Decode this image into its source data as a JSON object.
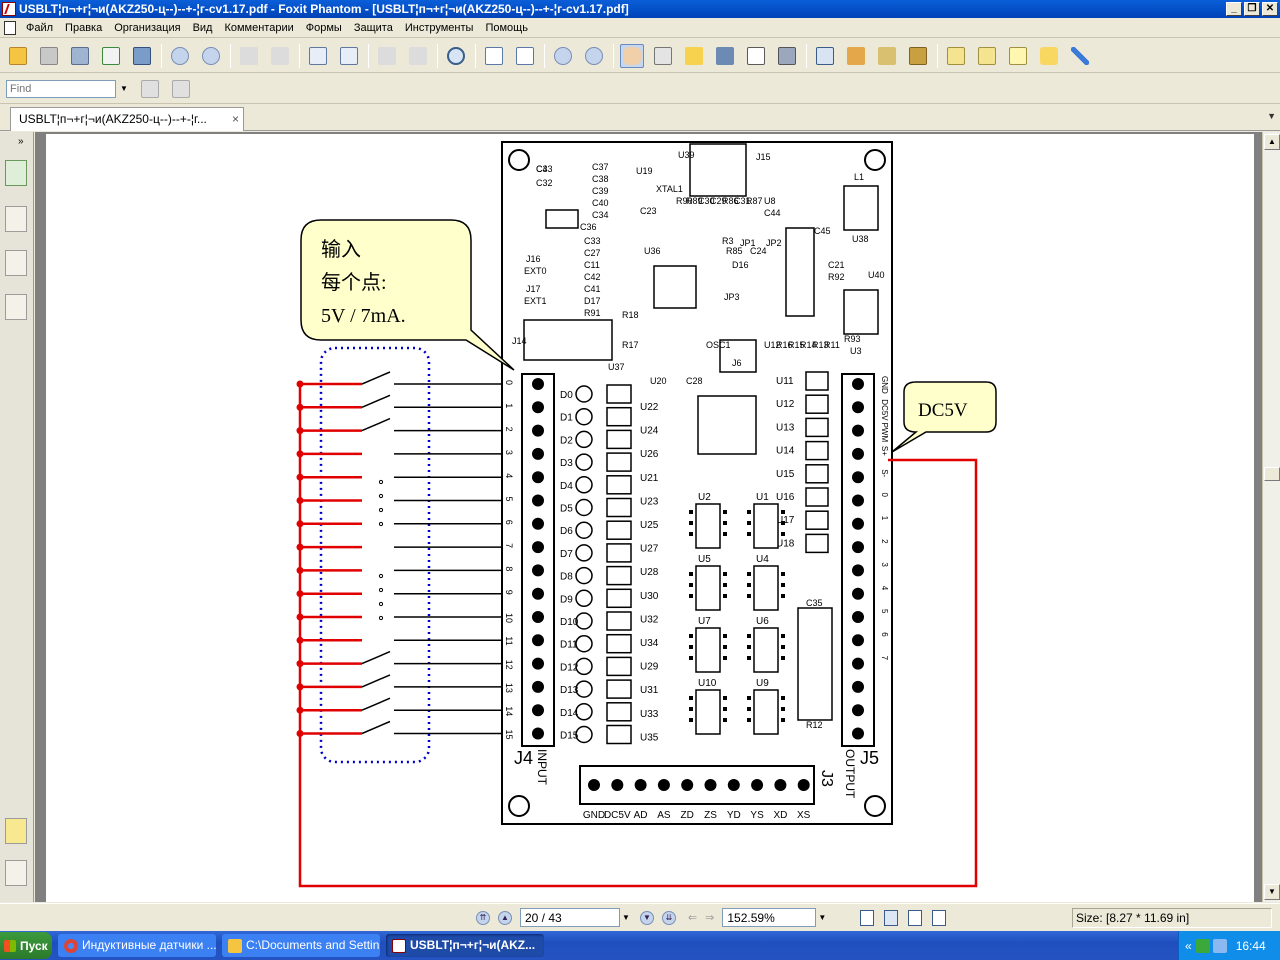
{
  "window": {
    "title": "USBLT¦п¬+г¦¬и(AKZ250-ц--)--+-¦г-cv1.17.pdf - Foxit Phantom - [USBLT¦п¬+г¦¬и(AKZ250-ц--)--+-¦г-cv1.17.pdf]",
    "btn_min": "_",
    "btn_restore": "❐",
    "btn_close": "✕"
  },
  "menu": {
    "items": [
      "Файл",
      "Правка",
      "Организация",
      "Вид",
      "Комментарии",
      "Формы",
      "Защита",
      "Инструменты",
      "Помощь"
    ]
  },
  "find": {
    "placeholder": "Find"
  },
  "tab": {
    "label": "USBLT¦п¬+г¦¬и(AKZ250-ц--)--+-¦г...",
    "close": "×"
  },
  "document": {
    "callout_input_line1": "输入",
    "callout_input_line2": "每个点:",
    "callout_input_line3": "5V / 7mA.",
    "callout_dc5v": "DC5V",
    "j4_label": "J4",
    "j4_sub": "INPUT",
    "j5_label": "J5",
    "j5_sub": "OUTPUT",
    "j3_label": "J3",
    "input_pins": [
      "0",
      "1",
      "2",
      "3",
      "4",
      "5",
      "6",
      "7",
      "8",
      "9",
      "10",
      "11",
      "12",
      "13",
      "14",
      "15"
    ],
    "led_labels": [
      "D0",
      "D1",
      "D2",
      "D3",
      "D4",
      "D5",
      "D6",
      "D7",
      "D8",
      "D9",
      "D10",
      "D11",
      "D12",
      "D13",
      "D14",
      "D15"
    ],
    "u_left_labels": [
      "U22",
      "U24",
      "U26",
      "U21",
      "U23",
      "U25",
      "U27",
      "U28",
      "U30",
      "U32",
      "U34",
      "U29",
      "U31",
      "U33",
      "U35"
    ],
    "output_pins": [
      "GND",
      "DC5V",
      "PWM",
      "S+",
      "S-",
      "0",
      "1",
      "2",
      "3",
      "4",
      "5",
      "6",
      "7"
    ],
    "out_u_labels": [
      "U11",
      "U12",
      "U13",
      "U14",
      "U15",
      "U16",
      "U17",
      "U18"
    ],
    "j3_pins": [
      "GND",
      "DC5V",
      "AD",
      "AS",
      "ZD",
      "ZS",
      "YD",
      "YS",
      "XD",
      "XS"
    ],
    "top_parts": [
      "C43",
      "C32",
      "C37",
      "C38",
      "C39",
      "C40",
      "C34",
      "C36",
      "C33",
      "C27",
      "C11",
      "C42",
      "C41",
      "D17",
      "R91",
      "R18",
      "R17",
      "J16",
      "EXT0",
      "J17",
      "EXT1",
      "J14",
      "U37",
      "U20",
      "C28",
      "U36",
      "U39",
      "J15",
      "L1",
      "U8",
      "C44",
      "C45",
      "U38",
      "U40",
      "C21",
      "R92",
      "R93",
      "U3",
      "D16",
      "JP1",
      "JP2",
      "JP3",
      "J6",
      "OSC1",
      "U12",
      "R16",
      "R15",
      "R14",
      "R13",
      "R11",
      "R12",
      "C35",
      "U19",
      "XTAL1",
      "C23",
      "R90",
      "R89",
      "C30",
      "C29",
      "R86",
      "C31",
      "R87",
      "R3",
      "R85",
      "C24",
      "C3"
    ],
    "ic_labels": [
      "U2",
      "U1",
      "U5",
      "U4",
      "U7",
      "U6",
      "U10",
      "U9"
    ]
  },
  "status": {
    "page_value": "20 / 43",
    "zoom_value": "152.59%",
    "size": "Size: [8.27 * 11.69 in]"
  },
  "taskbar": {
    "start": "Пуск",
    "tasks": [
      "Индуктивные датчики ...",
      "C:\\Documents and Settin...",
      "USBLT¦п¬+г¦¬и(AKZ..."
    ],
    "chevron": "«",
    "clock": "16:44"
  },
  "colors": {
    "title_bar": "#0042b8",
    "wire_red": "#e00000",
    "dotted_blue": "#0000c8",
    "callout_fill": "#ffffcc"
  }
}
